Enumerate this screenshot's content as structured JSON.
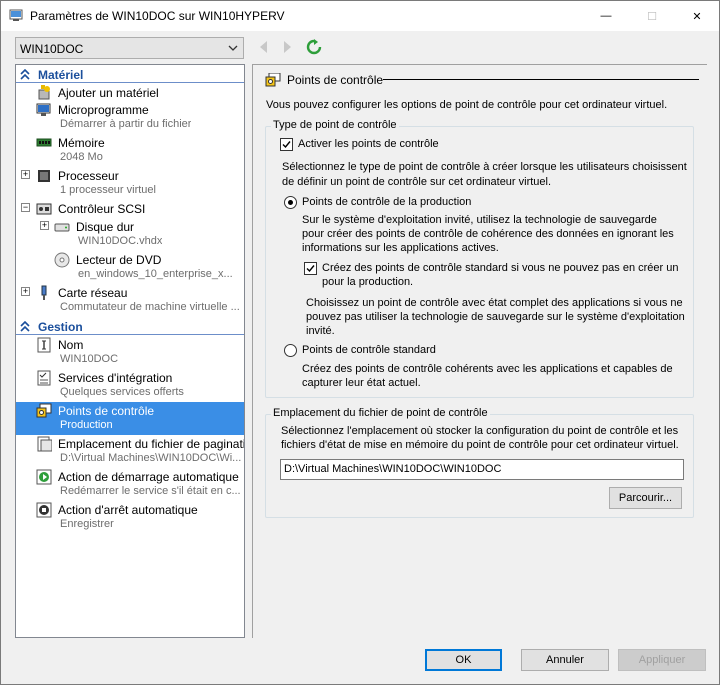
{
  "window": {
    "title": "Paramètres de WIN10DOC sur WIN10HYPERV",
    "minimize_glyph": "—",
    "maximize_glyph": "☐",
    "close_glyph": "✕"
  },
  "toolbar": {
    "vm_selected": "WIN10DOC"
  },
  "sidebar": {
    "hardware_header": "Matériel",
    "management_header": "Gestion",
    "items": [
      {
        "name": "Ajouter un matériel",
        "sub": ""
      },
      {
        "name": "Microprogramme",
        "sub": "Démarrer à partir du fichier"
      },
      {
        "name": "Mémoire",
        "sub": "2048 Mo"
      },
      {
        "name": "Processeur",
        "sub": "1 processeur virtuel"
      },
      {
        "name": "Contrôleur SCSI",
        "sub": ""
      },
      {
        "name": "Disque dur",
        "sub": "WIN10DOC.vhdx"
      },
      {
        "name": "Lecteur de DVD",
        "sub": "en_windows_10_enterprise_x..."
      },
      {
        "name": "Carte réseau",
        "sub": "Commutateur de machine virtuelle ..."
      },
      {
        "name": "Nom",
        "sub": "WIN10DOC"
      },
      {
        "name": "Services d'intégration",
        "sub": "Quelques services offerts"
      },
      {
        "name": "Points de contrôle",
        "sub": "Production"
      },
      {
        "name": "Emplacement du fichier de paginatio...",
        "sub": "D:\\Virtual Machines\\WIN10DOC\\Wi..."
      },
      {
        "name": "Action de démarrage automatique",
        "sub": "Redémarrer le service s'il était en c..."
      },
      {
        "name": "Action d'arrêt automatique",
        "sub": "Enregistrer"
      }
    ]
  },
  "main": {
    "title": "Points de contrôle",
    "intro": "Vous pouvez configurer les options de point de contrôle pour cet ordinateur virtuel.",
    "type_group": "Type de point de contrôle",
    "enable_checkbox": "Activer les points de contrôle",
    "enable_checked": true,
    "select_text_1": "Sélectionnez le type de point de contrôle à créer lorsque les utilisateurs choisissent",
    "select_text_2": "de définir un point de contrôle sur cet ordinateur virtuel.",
    "production_radio": "Points de contrôle de la production",
    "production_selected": true,
    "production_desc_1": "Sur le système d'exploitation invité, utilisez la technologie de sauvegarde",
    "production_desc_2": "pour créer des points de contrôle de cohérence des données en ignorant les",
    "production_desc_3": "informations sur les applications actives.",
    "fallback_checkbox_1": "Créez des points de contrôle standard si vous ne pouvez pas en créer un",
    "fallback_checkbox_2": "pour la production.",
    "fallback_checked": true,
    "fallback_desc_1": "Choisissez un point de contrôle avec état complet des applications si vous ne",
    "fallback_desc_2": "pouvez pas utiliser la technologie de sauvegarde sur le système d'exploitation",
    "fallback_desc_3": "invité.",
    "standard_radio": "Points de contrôle standard",
    "standard_desc_1": "Créez des points de contrôle cohérents avec les applications et capables de",
    "standard_desc_2": "capturer leur état actuel.",
    "location_group": "Emplacement du fichier de point de contrôle",
    "location_desc_1": "Sélectionnez l'emplacement où stocker la configuration du point de contrôle et les",
    "location_desc_2": "fichiers d'état de mise en mémoire du point de contrôle pour cet ordinateur virtuel.",
    "location_value": "D:\\Virtual Machines\\WIN10DOC\\WIN10DOC",
    "browse_button": "Parcourir..."
  },
  "footer": {
    "ok": "OK",
    "cancel": "Annuler",
    "apply": "Appliquer"
  },
  "colors": {
    "selection": "#3a8ee6",
    "section_header": "#1b4f9c"
  }
}
